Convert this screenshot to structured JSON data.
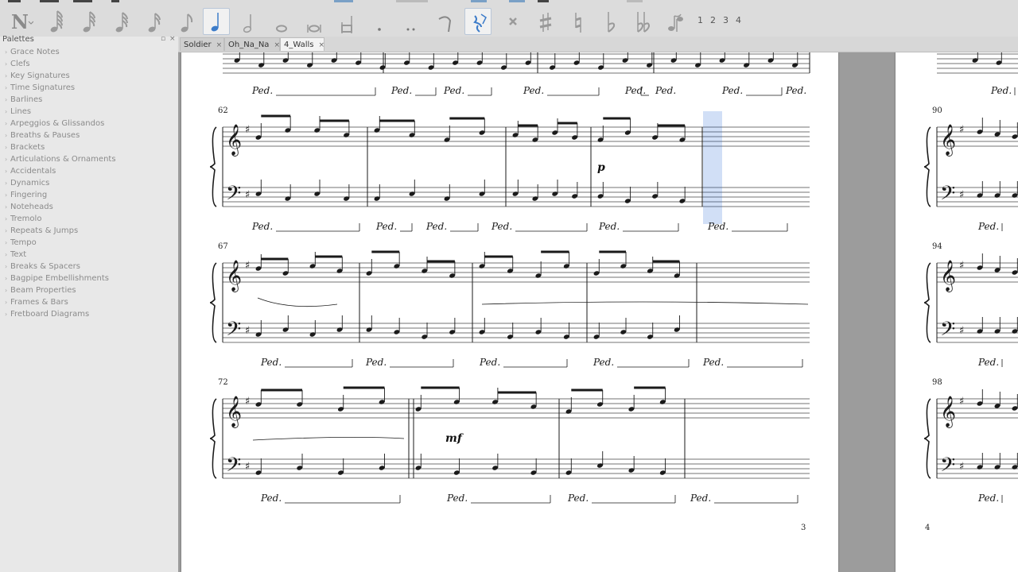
{
  "toolbar": {
    "note_input_icon": "note-input-icon",
    "durations": [
      "128th",
      "64th",
      "32nd",
      "16th",
      "eighth",
      "quarter",
      "half",
      "whole",
      "breve",
      "longa"
    ],
    "active_duration": "quarter",
    "modifiers": [
      "augmentation-dot",
      "double-dot",
      "tie",
      "rest",
      "toggle-x",
      "sharp",
      "natural",
      "flat",
      "double-flat",
      "flip-direction"
    ],
    "voices": [
      "1",
      "2",
      "3",
      "4"
    ]
  },
  "palette": {
    "title": "Palettes",
    "items": [
      "Grace Notes",
      "Clefs",
      "Key Signatures",
      "Time Signatures",
      "Barlines",
      "Lines",
      "Arpeggios & Glissandos",
      "Breaths & Pauses",
      "Brackets",
      "Articulations & Ornaments",
      "Accidentals",
      "Dynamics",
      "Fingering",
      "Noteheads",
      "Tremolo",
      "Repeats & Jumps",
      "Tempo",
      "Text",
      "Breaks & Spacers",
      "Bagpipe Embellishments",
      "Beam Properties",
      "Frames & Bars",
      "Fretboard Diagrams"
    ]
  },
  "tabs": [
    {
      "label": "Soldier",
      "active": false
    },
    {
      "label": "Oh_Na_Na",
      "active": false
    },
    {
      "label": "4_Walls",
      "active": true
    }
  ],
  "score": {
    "page_left_number": "3",
    "page_right_number": "4",
    "systems_left": [
      {
        "measure_number": "",
        "pedal_marks": 7
      },
      {
        "measure_number": "62",
        "pedal_marks": 6
      },
      {
        "measure_number": "67",
        "pedal_marks": 5
      },
      {
        "measure_number": "72",
        "pedal_marks": 4
      }
    ],
    "systems_right": [
      "",
      "90",
      "94",
      "98"
    ],
    "pedal_text": "Ped.",
    "dynamics": [
      {
        "label": "p",
        "system": 1
      },
      {
        "label": "mf",
        "system": 3
      }
    ],
    "selection_color": "#2d6fd6"
  }
}
